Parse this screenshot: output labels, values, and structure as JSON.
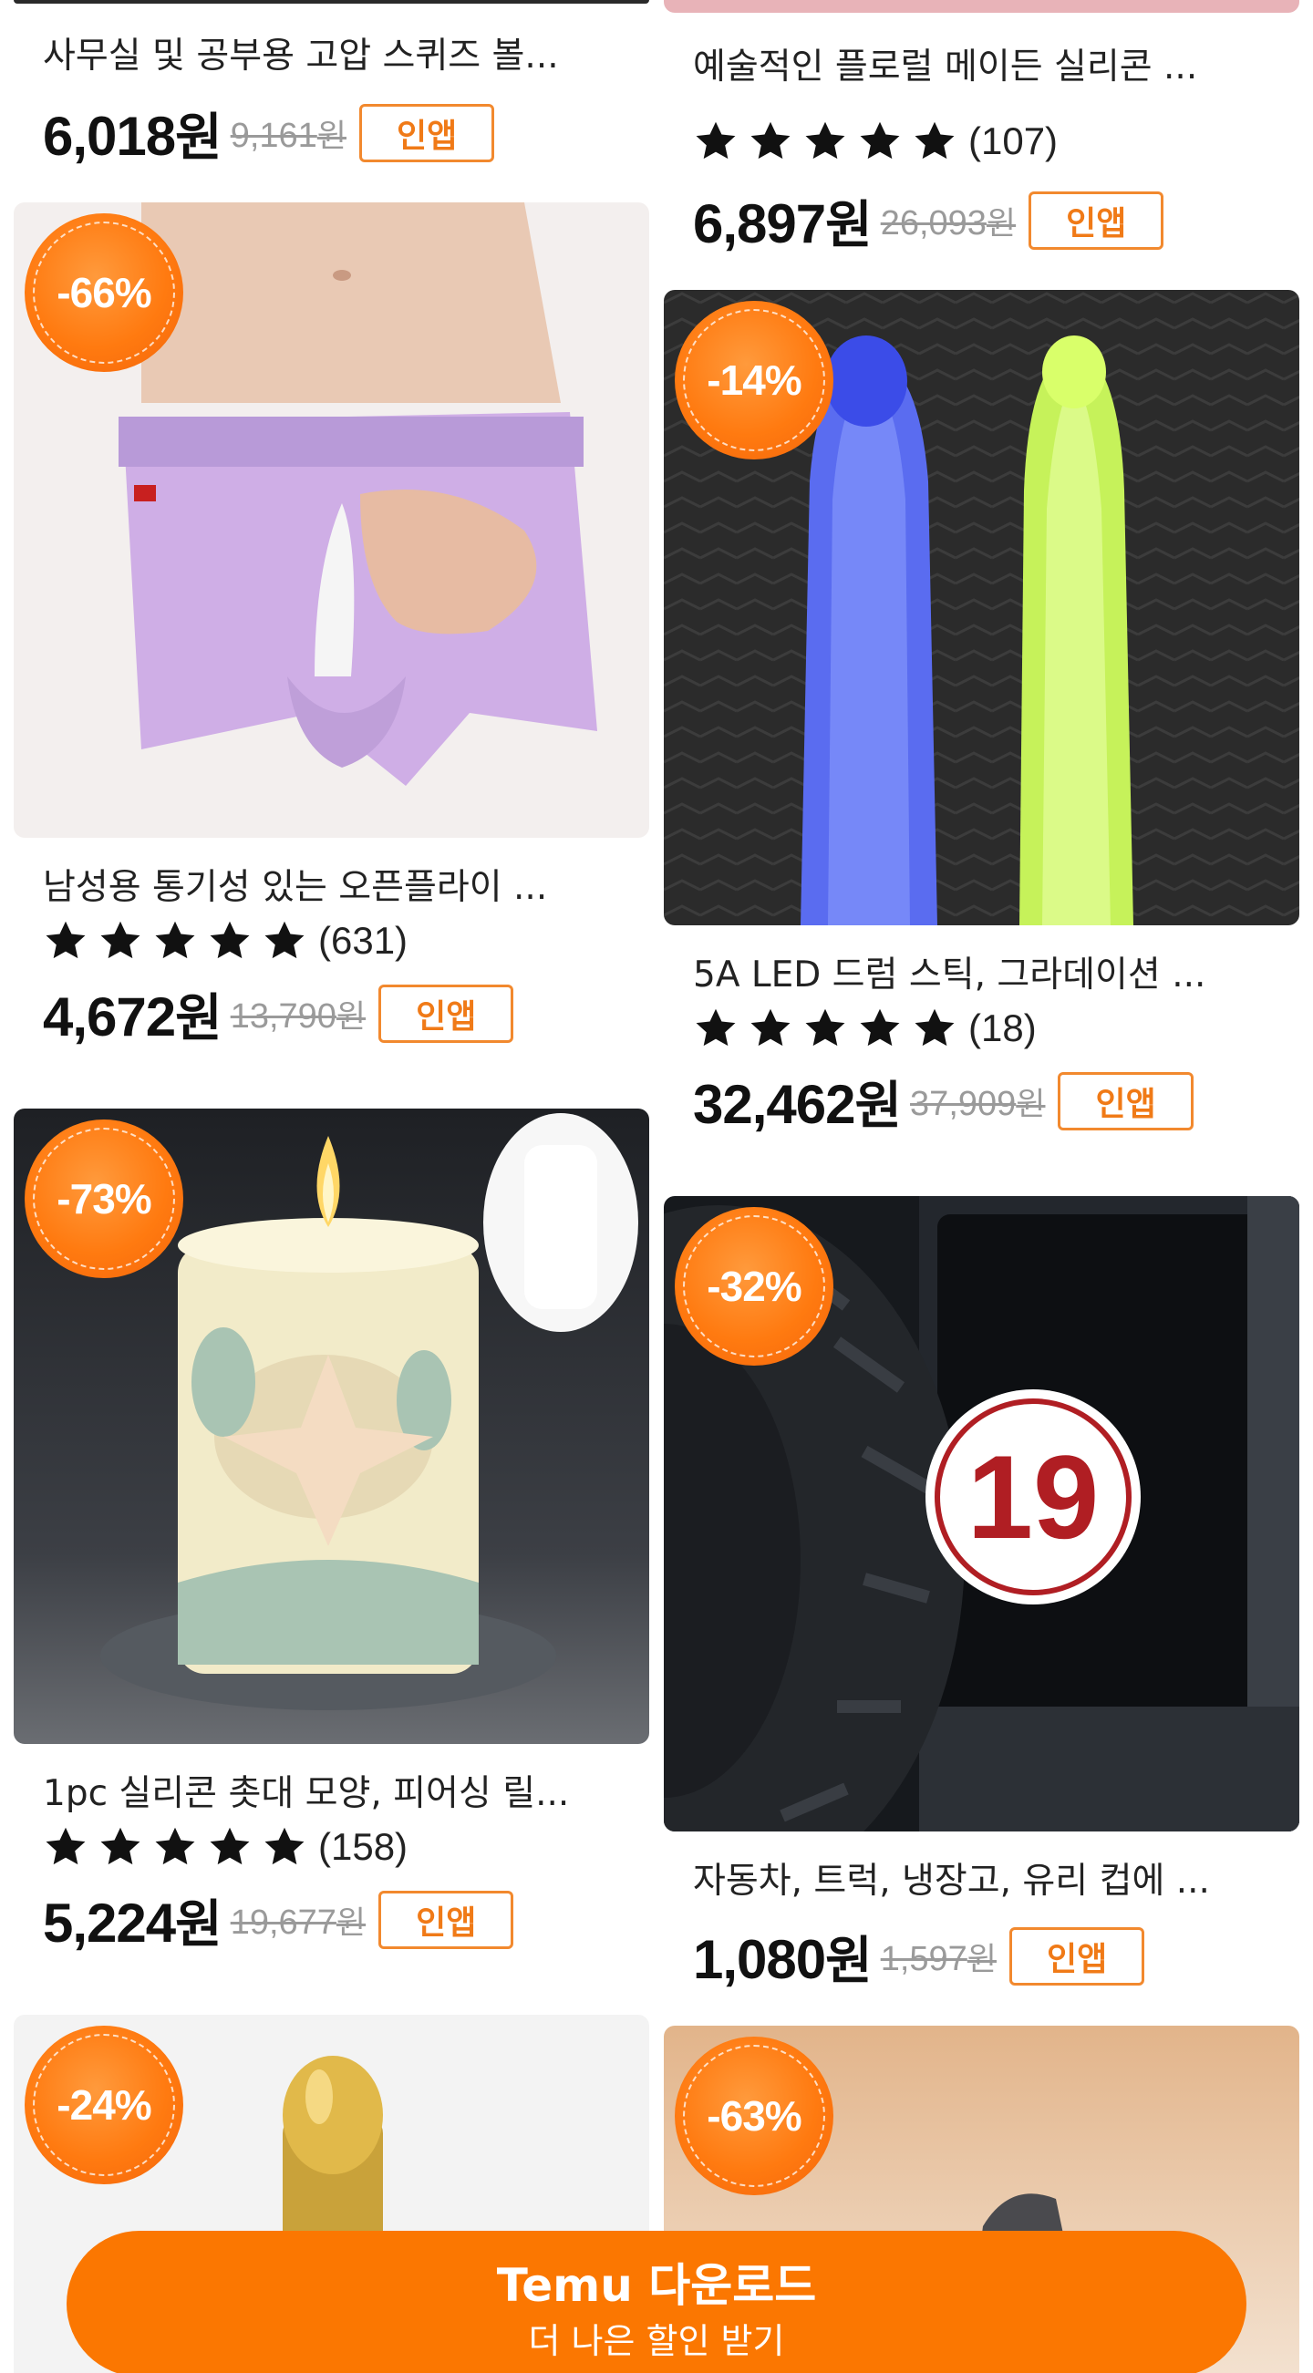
{
  "colors": {
    "accent": "#fb7701",
    "badge": "#ff7a10",
    "button_border": "#f2892e",
    "strike": "#9a9a9a"
  },
  "left": [
    {
      "title": "사무실 및 공부용 고압 스퀴즈 볼...",
      "price": "6,018",
      "orig": "9,161",
      "rating": null
    },
    {
      "discount": "-66%",
      "title": "남성용 통기성 있는 오픈플라이 ...",
      "count": "(631)",
      "stars": 5,
      "price": "4,672",
      "orig": "13,790"
    },
    {
      "discount": "-73%",
      "title": "1pc 실리콘 촛대 모양, 피어싱 릴...",
      "count": "(158)",
      "stars": 5,
      "price": "5,224",
      "orig": "19,677"
    },
    {
      "discount": "-24%"
    }
  ],
  "right": [
    {
      "title": "예술적인 플로럴 메이든 실리콘 ...",
      "count": "(107)",
      "stars": 5,
      "price": "6,897",
      "orig": "26,093"
    },
    {
      "discount": "-14%",
      "title": "5A LED 드럼 스틱, 그라데이션 ...",
      "count": "(18)",
      "stars": 5,
      "price": "32,462",
      "orig": "37,909"
    },
    {
      "discount": "-32%",
      "title": "자동차, 트럭, 냉장고, 유리 컵에 ...",
      "price": "1,080",
      "orig": "1,597",
      "image_text": "19"
    },
    {
      "discount": "-63%"
    }
  ],
  "labels": {
    "won": "원",
    "in_app": "인앱"
  },
  "cta": {
    "title": "Temu 다운로드",
    "subtitle": "더 나은 할인 받기"
  }
}
